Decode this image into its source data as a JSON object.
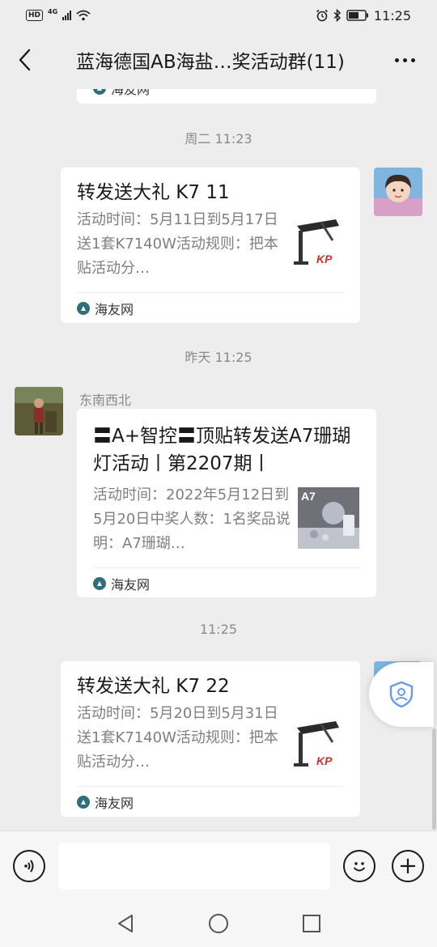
{
  "status_bar": {
    "hd": "HD",
    "network": "4G",
    "time": "11:25"
  },
  "header": {
    "title": "蓝海德国AB海盐…奖活动群(11)"
  },
  "messages": [
    {
      "time": "周二 11:23",
      "title": "转发送大礼 K7 11",
      "desc": "活动时间：5月11日到5月17日送1套K7140W活动规则：把本贴活动分…",
      "source": "海友网"
    },
    {
      "time": "昨天 11:25",
      "sender": "东南西北",
      "title": "〓A+智控〓顶贴转发送A7珊瑚灯活动丨第2207期丨",
      "desc": "活动时间：2022年5月12日到5月20日中奖人数：1名奖品说明：A7珊瑚…",
      "source": "海友网",
      "thumb_label": "A7"
    },
    {
      "time": "11:25",
      "title": "转发送大礼 K7 22",
      "desc": "活动时间：5月20日到5月31日送1套K7140W活动规则：把本贴活动分…",
      "source": "海友网"
    }
  ],
  "prev_card": {
    "source": "海友网"
  },
  "thumb_brand": "KP",
  "colors": {
    "background": "#ededed",
    "card": "#ffffff",
    "site_logo": "#2f6f7a"
  }
}
